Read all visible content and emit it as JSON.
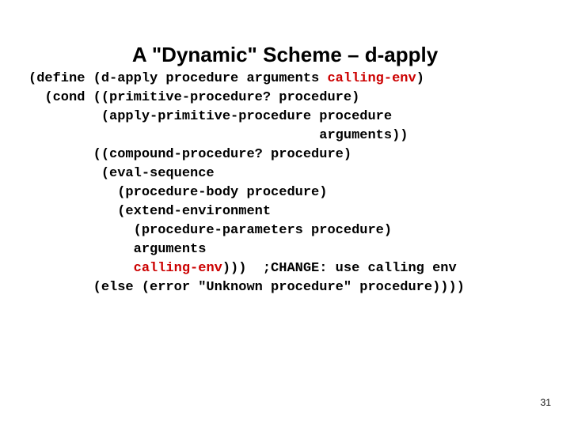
{
  "title": "A \"Dynamic\" Scheme – d-apply",
  "code": {
    "c1a": "(define (d-apply procedure arguments ",
    "c1b": "calling-env",
    "c1c": ")",
    "c2": "  (cond ((primitive-procedure? procedure)",
    "c3": "         (apply-primitive-procedure procedure",
    "c4": "                                    arguments))",
    "c5": "        ((compound-procedure? procedure)",
    "c6": "         (eval-sequence",
    "c7": "           (procedure-body procedure)",
    "c8": "           (extend-environment",
    "c9": "             (procedure-parameters procedure)",
    "c10": "             arguments",
    "c11a": "             ",
    "c11b": "calling-env",
    "c11c": ")))  ;CHANGE: use calling env",
    "c12": "        (else (error \"Unknown procedure\" procedure))))"
  },
  "page_number": "31"
}
